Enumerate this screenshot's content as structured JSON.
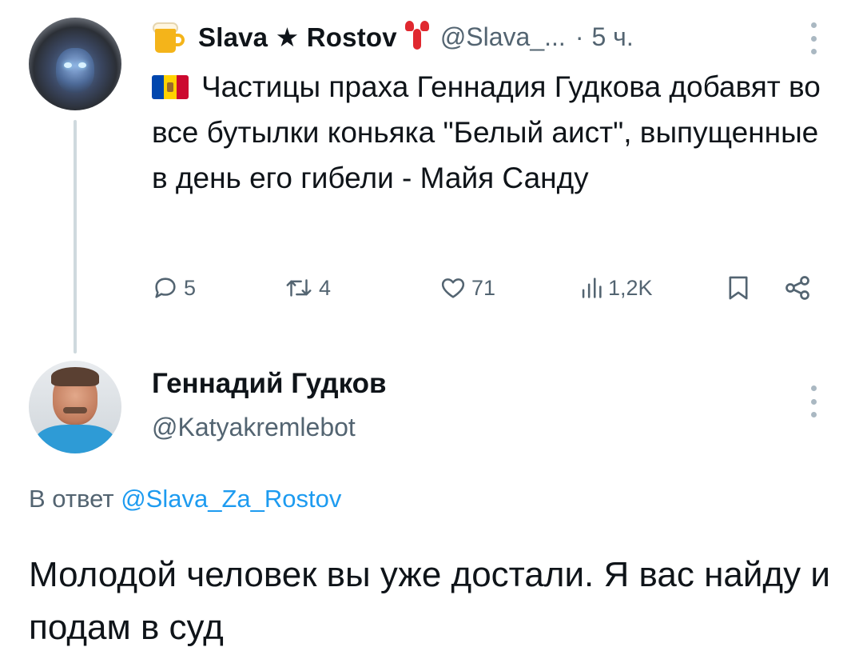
{
  "tweet1": {
    "display_name": "Slava ★ Rostov",
    "handle": "@Slava_...",
    "separator": "·",
    "time": "5 ч.",
    "body": "Частицы праха Геннадия Гудкова добавят во все бутылки коньяка \"Белый аист\", выпущенные в день его гибели - Майя Санду",
    "icons": {
      "name_prefix": "beer-mug-icon",
      "name_suffix": "lobster-icon",
      "body_prefix": "moldova-flag-icon"
    },
    "actions": {
      "replies": "5",
      "retweets": "4",
      "likes": "71",
      "views": "1,2K"
    }
  },
  "tweet2": {
    "display_name": "Геннадий Гудков",
    "handle": "@Katyakremlebot",
    "reply_prefix": "В ответ",
    "reply_mention": "@Slava_Za_Rostov",
    "body": "Молодой человек вы уже достали. Я вас найду и подам в суд"
  },
  "colors": {
    "text_primary": "#0f1419",
    "text_secondary": "#536471",
    "link": "#1d9bf0",
    "thread_line": "#cfd9de"
  }
}
